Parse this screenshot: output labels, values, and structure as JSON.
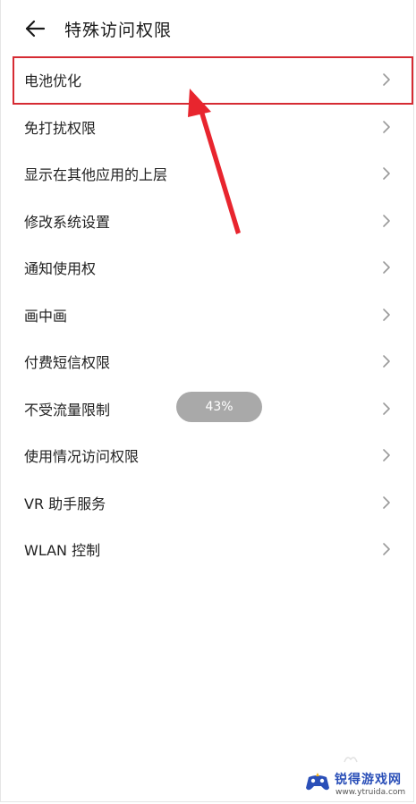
{
  "header": {
    "title": "特殊访问权限",
    "back_icon": "arrow-left-icon"
  },
  "items": [
    {
      "label": "电池优化"
    },
    {
      "label": "免打扰权限"
    },
    {
      "label": "显示在其他应用的上层"
    },
    {
      "label": "修改系统设置"
    },
    {
      "label": "通知使用权"
    },
    {
      "label": "画中画"
    },
    {
      "label": "付费短信权限"
    },
    {
      "label": "不受流量限制"
    },
    {
      "label": "使用情况访问权限"
    },
    {
      "label": "VR 助手服务"
    },
    {
      "label": "WLAN 控制"
    }
  ],
  "toast": {
    "text": "43%"
  },
  "annotation": {
    "highlight_color": "#d62b33",
    "arrow_color": "#e8252e"
  },
  "watermark": {
    "name": "锐得游戏网",
    "url": "www.ytruida.com"
  }
}
